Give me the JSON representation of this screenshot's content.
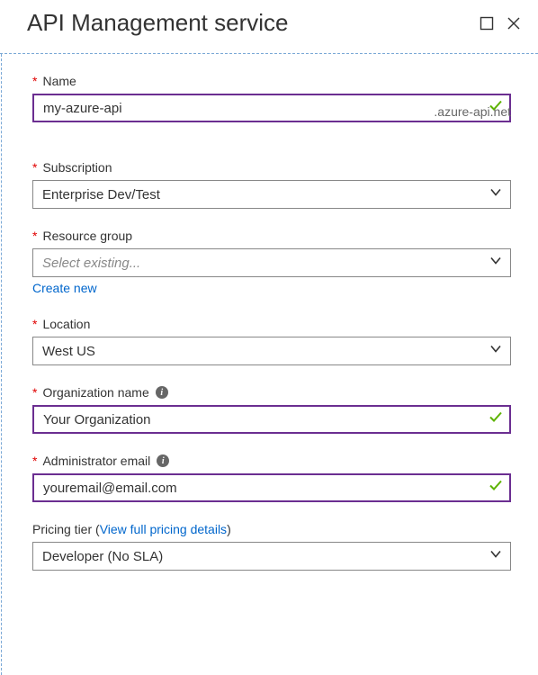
{
  "header": {
    "title": "API Management service"
  },
  "fields": {
    "name": {
      "label": "Name",
      "value": "my-azure-api",
      "suffix": ".azure-api.net"
    },
    "subscription": {
      "label": "Subscription",
      "value": "Enterprise Dev/Test"
    },
    "resourceGroup": {
      "label": "Resource group",
      "placeholder": "Select existing...",
      "createNewLabel": "Create new"
    },
    "location": {
      "label": "Location",
      "value": "West US"
    },
    "orgName": {
      "label": "Organization name",
      "value": "Your Organization"
    },
    "adminEmail": {
      "label": "Administrator email",
      "value": "youremail@email.com"
    },
    "pricingTier": {
      "labelPrefix": "Pricing tier (",
      "link": "View full pricing details",
      "labelSuffix": ")",
      "value": "Developer (No SLA)"
    }
  }
}
